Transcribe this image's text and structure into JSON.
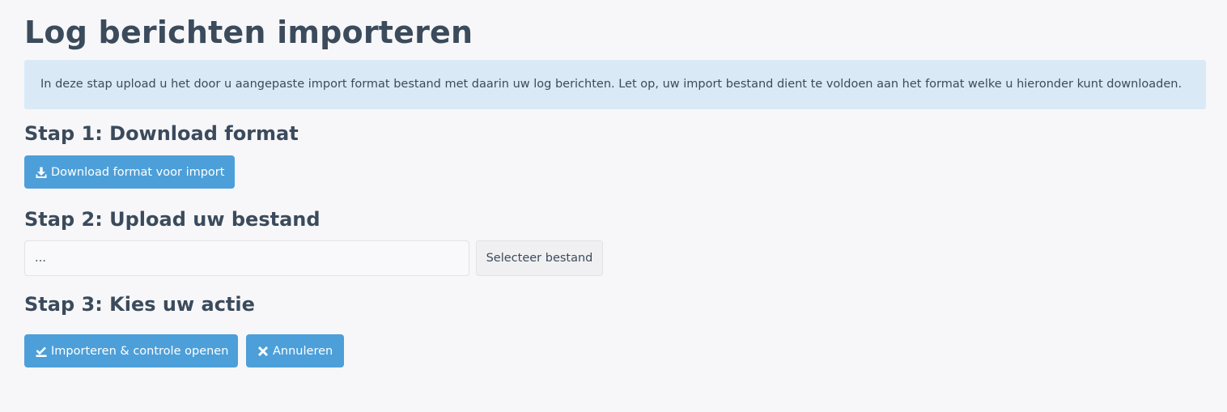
{
  "page": {
    "title": "Log berichten importeren",
    "info_text": "In deze stap upload u het door u aangepaste import format bestand met daarin uw log berichten. Let op, uw import bestand dient te voldoen aan het format welke u hieronder kunt downloaden."
  },
  "step1": {
    "heading": "Stap 1: Download format",
    "download_button": {
      "label": "Download format voor import",
      "icon": "download-icon"
    }
  },
  "step2": {
    "heading": "Stap 2: Upload uw bestand",
    "file_input": {
      "value": "..."
    },
    "select_button": {
      "label": "Selecteer bestand"
    }
  },
  "step3": {
    "heading": "Stap 3: Kies uw actie",
    "import_button": {
      "label": "Importeren & controle openen",
      "icon": "check-import-icon"
    },
    "cancel_button": {
      "label": "Annuleren",
      "icon": "close-icon"
    }
  },
  "colors": {
    "background": "#f7f7f9",
    "text": "#3b4b5c",
    "info_background": "#d9eaf6",
    "primary_button": "#4c9fd9",
    "secondary_button": "#f0f0f2"
  }
}
